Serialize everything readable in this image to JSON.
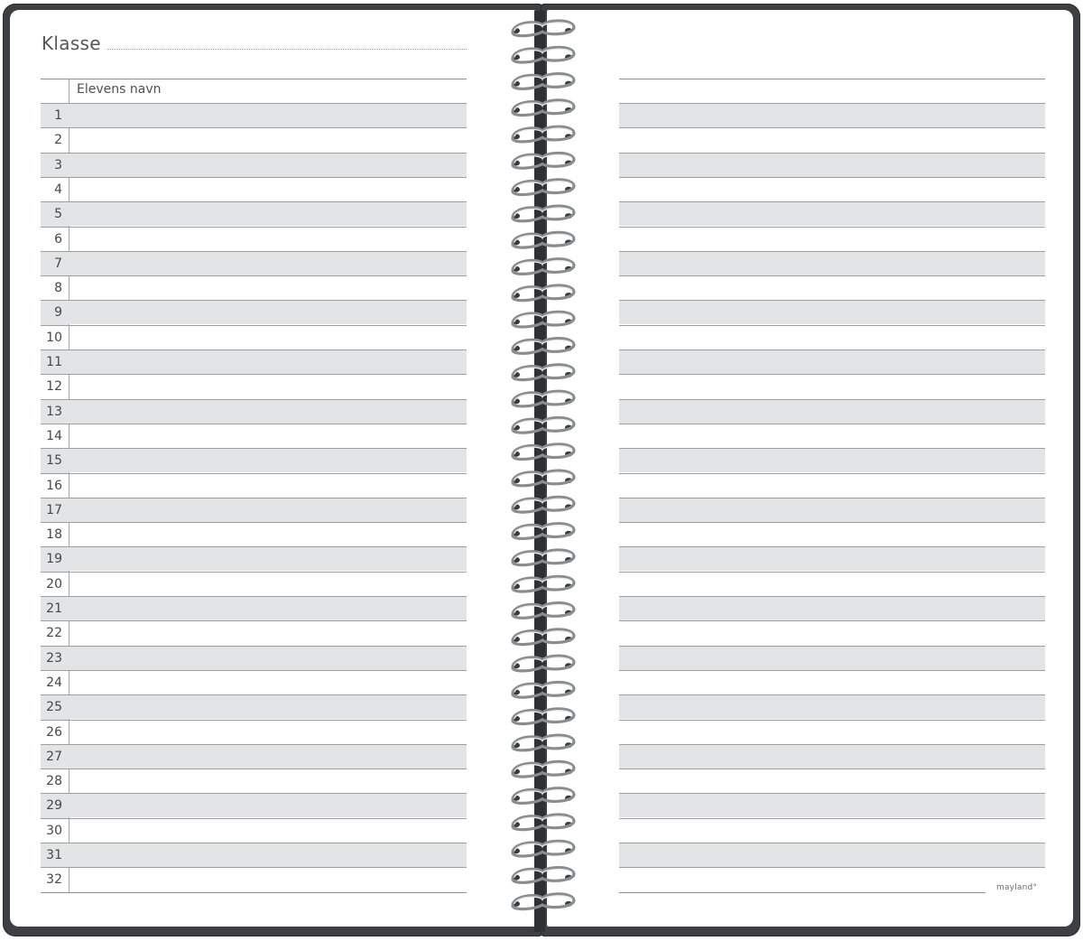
{
  "left_page": {
    "klasse_label": "Klasse",
    "column_header": "Elevens navn",
    "row_numbers": [
      "1",
      "2",
      "3",
      "4",
      "5",
      "6",
      "7",
      "8",
      "9",
      "10",
      "11",
      "12",
      "13",
      "14",
      "15",
      "16",
      "17",
      "18",
      "19",
      "20",
      "21",
      "22",
      "23",
      "24",
      "25",
      "26",
      "27",
      "28",
      "29",
      "30",
      "31",
      "32"
    ]
  },
  "right_page": {
    "brand": "mayland°"
  },
  "colors": {
    "cover": "#3d3f42",
    "row_shade": "#e3e4e6",
    "text": "#54565a"
  },
  "binding": {
    "type": "spiral-wire",
    "rings": 34
  }
}
